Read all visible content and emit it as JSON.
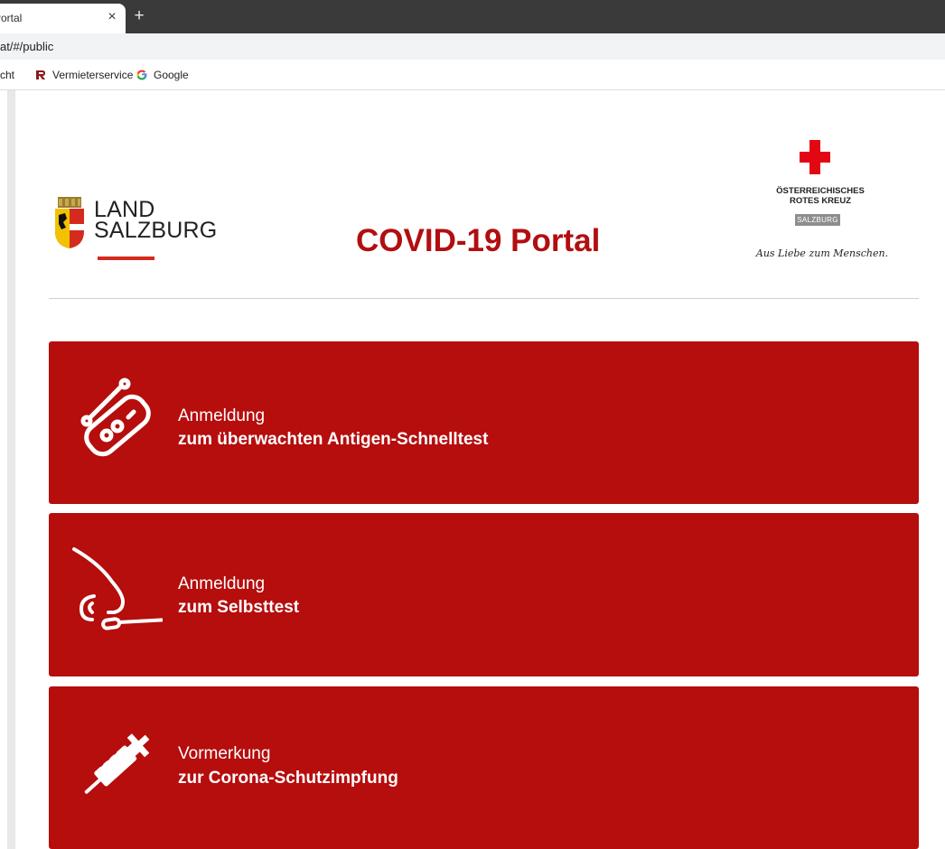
{
  "browser": {
    "tab_title": "Portal",
    "tab_close": "×",
    "new_tab": "+",
    "url": "at/#/public",
    "bookmarks": [
      {
        "label": "cht"
      },
      {
        "label": "Vermieterservice"
      },
      {
        "label": "Google"
      }
    ]
  },
  "header": {
    "land_line1": "LAND",
    "land_line2": "SALZBURG",
    "title": "COVID-19 Portal",
    "rk_line1": "ÖSTERREICHISCHES",
    "rk_line2": "ROTES KREUZ",
    "rk_region": "SALZBURG",
    "rk_slogan": "Aus Liebe zum Menschen."
  },
  "cards": [
    {
      "line1": "Anmeldung",
      "line2": "zum überwachten Antigen-Schnelltest",
      "icon": "antigen-test-icon"
    },
    {
      "line1": "Anmeldung",
      "line2": "zum Selbsttest",
      "icon": "nose-swab-icon"
    },
    {
      "line1": "Vormerkung",
      "line2": "zur Corona-Schutzimpfung",
      "icon": "syringe-icon"
    }
  ],
  "colors": {
    "brand_red": "#b60d0d",
    "title_red": "#b20e10",
    "cross_red": "#e30613",
    "land_red": "#d52b1e"
  }
}
